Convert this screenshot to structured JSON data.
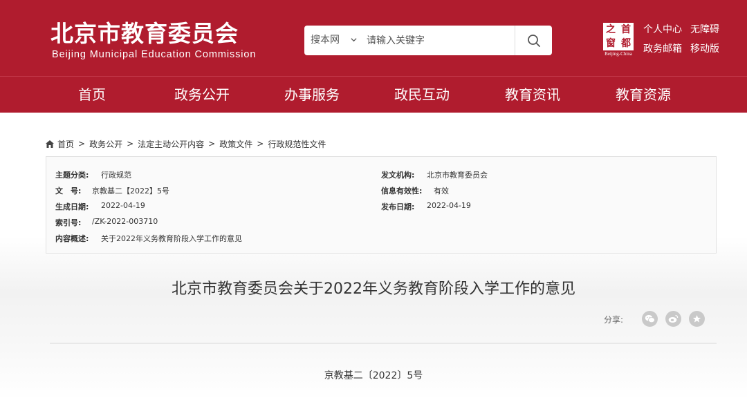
{
  "header": {
    "logo_cn": "北京市教育委员会",
    "logo_en": "Beijing Municipal Education Commission",
    "emblem_chars": [
      "之",
      "首",
      "窗",
      "都"
    ],
    "emblem_sub": "Beijing-China",
    "brand_color": "#b01c2e"
  },
  "search": {
    "scope": "搜本网",
    "placeholder": "请输入关键字"
  },
  "toplinks": {
    "personal_center": "个人中心",
    "accessibility": "无障碍",
    "gov_mail": "政务邮箱",
    "mobile": "移动版"
  },
  "nav": {
    "items": [
      "首页",
      "政务公开",
      "办事服务",
      "政民互动",
      "教育资讯",
      "教育资源"
    ]
  },
  "breadcrumb": {
    "items": [
      "首页",
      "政务公开",
      "法定主动公开内容",
      "政策文件",
      "行政规范性文件"
    ],
    "separator": ">"
  },
  "meta": {
    "subject_label": "主题分类:",
    "subject_value": "行政规范",
    "issuer_label": "发文机构:",
    "issuer_value": "北京市教育委员会",
    "docno_label": "文　号:",
    "docno_value": "京教基二【2022】5号",
    "validity_label": "信息有效性:",
    "validity_value": "有效",
    "created_label": "生成日期:",
    "created_value": "2022-04-19",
    "published_label": "发布日期:",
    "published_value": "2022-04-19",
    "index_label": "索引号:",
    "index_value": "/ZK-2022-003710",
    "summary_label": "内容概述:",
    "summary_value": "关于2022年义务教育阶段入学工作的意见"
  },
  "document": {
    "title": "北京市教育委员会关于2022年义务教育阶段入学工作的意见",
    "share_label": "分享:",
    "share_icons": [
      "wechat-icon",
      "weibo-icon",
      "favorite-icon"
    ],
    "doc_number": "京教基二〔2022〕5号"
  }
}
